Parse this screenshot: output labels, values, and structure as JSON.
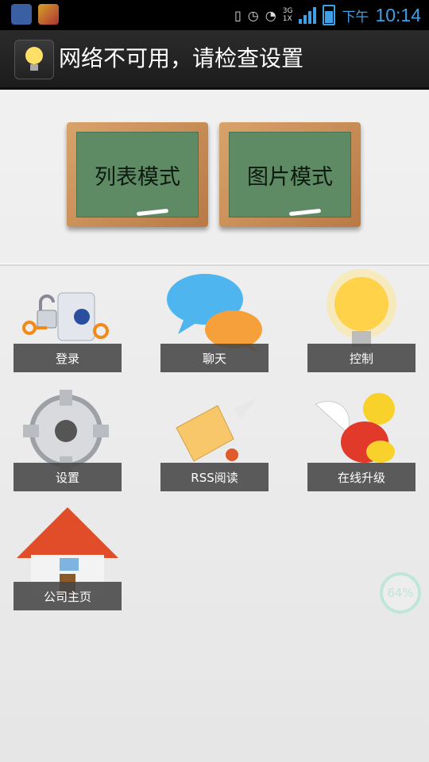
{
  "status_bar": {
    "network_label": "3G",
    "network_sub": "1X",
    "ampm": "下午",
    "time": "10:14"
  },
  "title_bar": {
    "title": "网络不可用，请检查设置"
  },
  "boards": [
    {
      "label": "列表模式"
    },
    {
      "label": "图片模式"
    }
  ],
  "tiles": [
    {
      "label": "登录",
      "icon": "lock-key-icon"
    },
    {
      "label": "聊天",
      "icon": "chat-bubbles-icon"
    },
    {
      "label": "控制",
      "icon": "light-bulb-icon"
    },
    {
      "label": "设置",
      "icon": "gear-icon"
    },
    {
      "label": "RSS阅读",
      "icon": "scroll-quill-icon"
    },
    {
      "label": "在线升级",
      "icon": "flying-turtle-icon"
    },
    {
      "label": "公司主页",
      "icon": "house-icon"
    }
  ],
  "progress_overlay": {
    "text": "64%",
    "value": 0.64
  }
}
